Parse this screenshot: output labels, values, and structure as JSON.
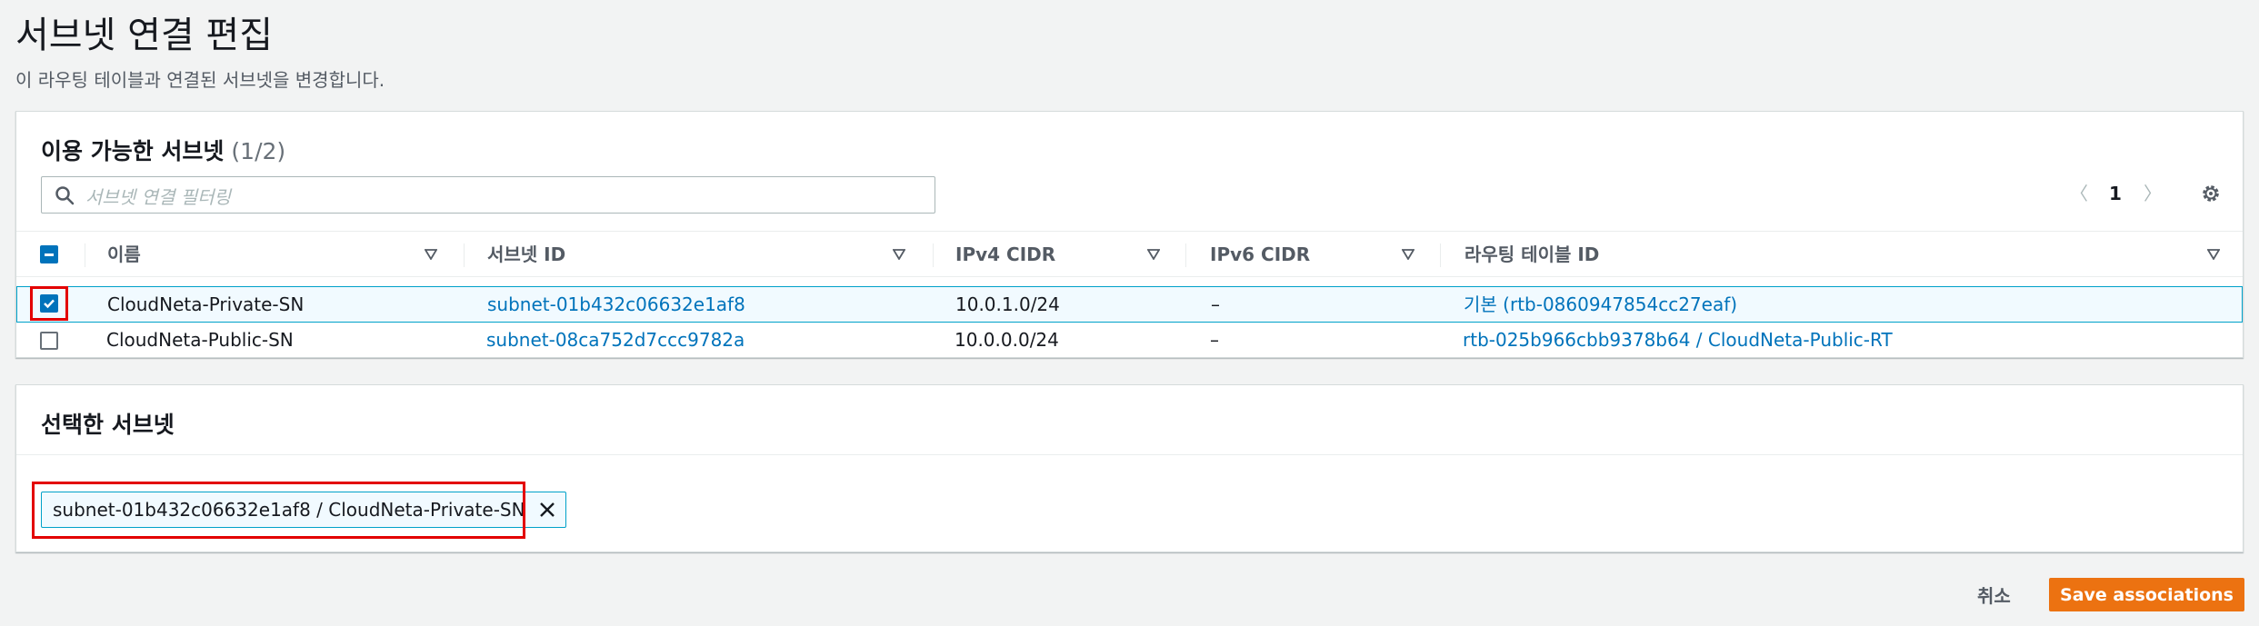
{
  "page": {
    "title": "서브넷 연결 편집",
    "description": "이 라우팅 테이블과 연결된 서브넷을 변경합니다."
  },
  "available": {
    "title": "이용 가능한 서브넷",
    "count": "(1/2)",
    "filter_placeholder": "서브넷 연결 필터링",
    "pagination": {
      "prev": "〈",
      "page": "1",
      "next": "〉"
    },
    "columns": [
      "이름",
      "서브넷 ID",
      "IPv4 CIDR",
      "IPv6 CIDR",
      "라우팅 테이블 ID"
    ],
    "rows": [
      {
        "checked": true,
        "name": "CloudNeta-Private-SN",
        "subnet_id": "subnet-01b432c06632e1af8",
        "ipv4": "10.0.1.0/24",
        "ipv6": "–",
        "route_table_prefix": "기본",
        "route_table": "(rtb-0860947854cc27eaf)"
      },
      {
        "checked": false,
        "name": "CloudNeta-Public-SN",
        "subnet_id": "subnet-08ca752d7ccc9782a",
        "ipv4": "10.0.0.0/24",
        "ipv6": "–",
        "route_table_prefix": "",
        "route_table": "rtb-025b966cbb9378b64 / CloudNeta-Public-RT"
      }
    ]
  },
  "selected": {
    "title": "선택한 서브넷",
    "tokens": [
      "subnet-01b432c06632e1af8 / CloudNeta-Private-SN"
    ]
  },
  "actions": {
    "cancel": "취소",
    "save": "Save associations"
  },
  "colors": {
    "primary": "#ec7211",
    "link": "#0073bb",
    "highlight": "#e30000"
  }
}
